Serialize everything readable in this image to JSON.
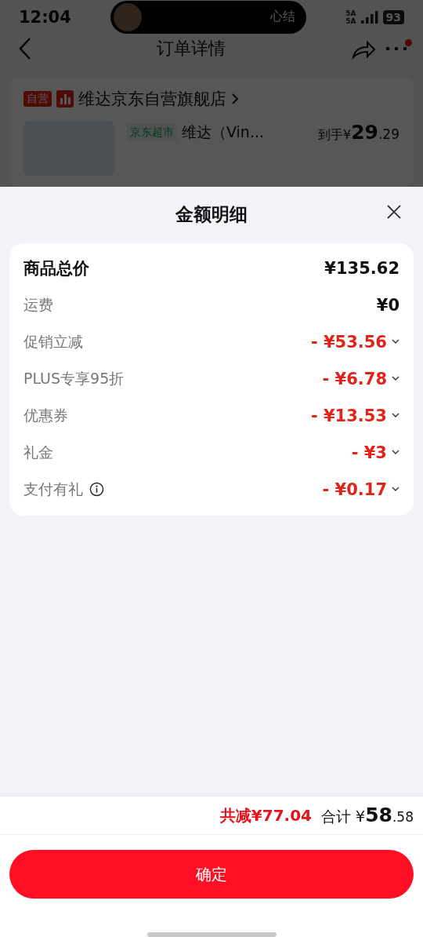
{
  "status_bar": {
    "time": "12:04",
    "island_text": "心结",
    "network_1": "5A",
    "network_2": "5A",
    "battery": "93"
  },
  "nav": {
    "title": "订单详情",
    "has_notification": true
  },
  "store": {
    "badge": "自营",
    "name": "维达京东自营旗舰店",
    "product_tag": "京东超市",
    "product_name": "维达（Vin...",
    "price_label": "到手",
    "price_currency": "¥",
    "price_int": "29",
    "price_dec": ".29"
  },
  "sheet": {
    "title": "金额明细",
    "rows": [
      {
        "kind": "total",
        "label": "商品总价",
        "value": "¥135.62",
        "info": false,
        "expandable": false
      },
      {
        "kind": "plain",
        "label": "运费",
        "value": "¥0",
        "info": false,
        "expandable": false
      },
      {
        "kind": "discount",
        "label": "促销立减",
        "value": "- ¥53.56",
        "info": false,
        "expandable": true
      },
      {
        "kind": "discount",
        "label": "PLUS专享95折",
        "value": "- ¥6.78",
        "info": false,
        "expandable": true
      },
      {
        "kind": "discount",
        "label": "优惠券",
        "value": "- ¥13.53",
        "info": false,
        "expandable": true
      },
      {
        "kind": "discount",
        "label": "礼金",
        "value": "- ¥3",
        "info": false,
        "expandable": true
      },
      {
        "kind": "discount",
        "label": "支付有礼",
        "value": "- ¥0.17",
        "info": true,
        "expandable": true
      }
    ]
  },
  "footer": {
    "saved_label": "共减",
    "saved_value": "¥77.04",
    "total_label": "合计",
    "total_currency": "¥",
    "total_int": "58",
    "total_dec": ".58",
    "confirm": "确定"
  }
}
